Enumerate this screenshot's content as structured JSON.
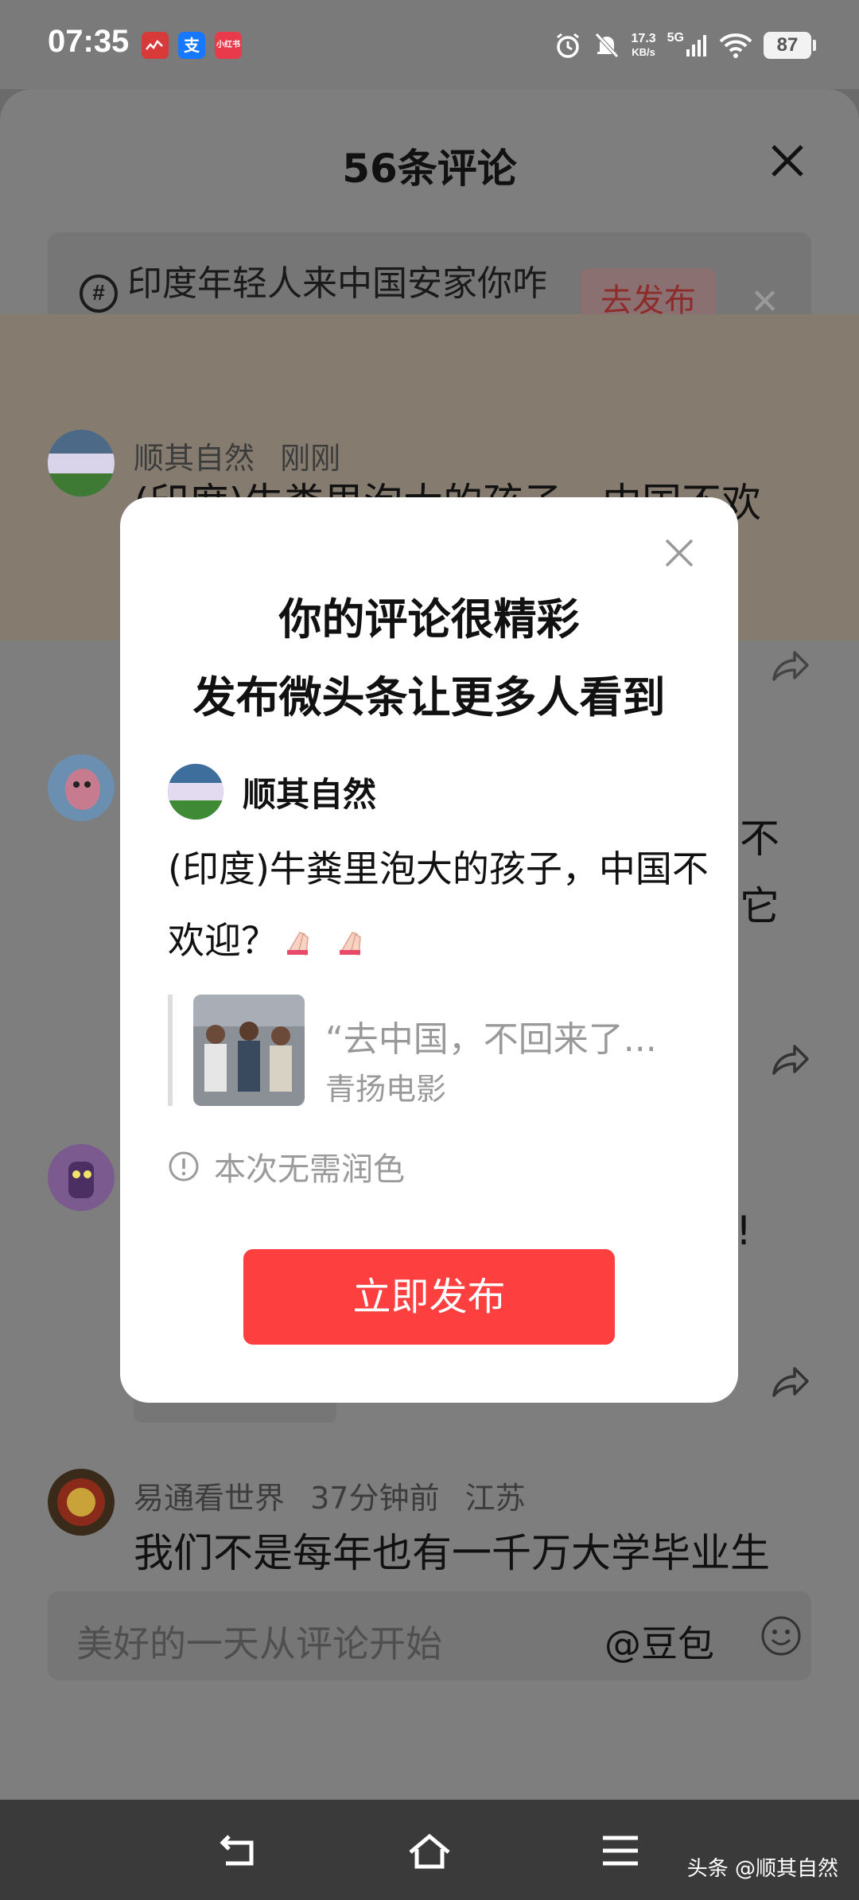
{
  "status_bar": {
    "time": "07:35",
    "apps": [
      "app-1",
      "支",
      "小红书"
    ],
    "network_speed_top": "17.3",
    "network_speed_bottom": "KB/s",
    "network_type": "5G",
    "battery": "87"
  },
  "sheet": {
    "title": "56条评论",
    "topic": {
      "icon": "hashtag-icon",
      "text": "印度年轻人来中国安家你咋看",
      "publish_label": "去发布"
    }
  },
  "comments": [
    {
      "user": "顺其自然",
      "time": "刚刚",
      "text_fragment": "(印度)牛粪里泡大的孩子，中国不欢"
    },
    {
      "right_fragments": [
        "不",
        "它"
      ]
    },
    {
      "right_fragments": [
        "!"
      ]
    },
    {
      "user": "易通看世界",
      "time": "37分钟前",
      "location": "江苏",
      "text": "我们不是每年也有一千万大学毕业生吗？加上没上大学的年轻人也要"
    }
  ],
  "input": {
    "placeholder": "美好的一天从评论开始",
    "mention": "@豆包"
  },
  "dialog": {
    "title_line1": "你的评论很精彩",
    "title_line2": "发布微头条让更多人看到",
    "username": "顺其自然",
    "comment_text": "(印度)牛粪里泡大的孩子，中国不欢迎？",
    "quote_title": "“去中国，不回来了...",
    "quote_source": "青扬电影",
    "notice": "本次无需润色",
    "publish_button": "立即发布"
  },
  "watermark": "头条 @顺其自然",
  "colors": {
    "accent_red": "#fe3f3f",
    "overlay_gray": "#7e7e7e",
    "dialog_bg": "#ffffff"
  }
}
